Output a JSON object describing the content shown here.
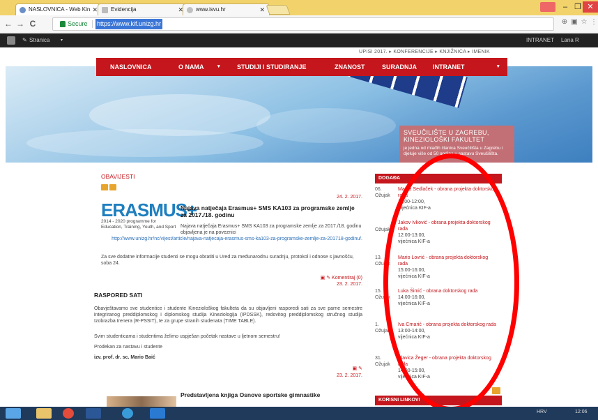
{
  "browser": {
    "tabs": [
      {
        "label": "NASLOVNICA - Web Kin"
      },
      {
        "label": "Evidencija"
      },
      {
        "label": "www.isvu.hr"
      }
    ],
    "user_badge": "",
    "window_controls": {
      "minimize": "–",
      "maximize": "❐",
      "close": "✕"
    },
    "back": "←",
    "forward": "→",
    "reload": "C",
    "secure_label": "Secure",
    "url": "https://www.kif.unizg.hr",
    "icons": [
      "zoom-icon",
      "translate-icon",
      "star-icon",
      "menu-icon"
    ]
  },
  "wp_admin": {
    "site_menu": "Stranica",
    "right_links": [
      "INTRANET",
      "Lana R"
    ]
  },
  "site": {
    "toplinks": "UPISI 2017.  ▸ KONFERENCIJE  ▸ KNJIŽNICA  ▸ IMENIK",
    "nav": [
      {
        "label": "NASLOVNICA"
      },
      {
        "label": "O NAMA"
      },
      {
        "label": "▾"
      },
      {
        "label": "STUDIJI I STUDIRANJE"
      },
      {
        "label": "ZNANOST"
      },
      {
        "label": "SURADNJA"
      },
      {
        "label": "INTRANET"
      },
      {
        "label": "▾"
      }
    ],
    "hero": {
      "title": "SVEUČILIŠTE U ZAGREBU, KINEZIOLOŠKI FAKULTET",
      "text": "je jedna od mlađih članica Sveučilišta u Zagrebu i djeluje više od 50 godina u sastavu Sveučilišta."
    },
    "news": {
      "heading": "OBAVIJESTI",
      "date1": "24. 2. 2017.",
      "erasmus_logo": "ERASMUS+",
      "erasmus_sub": "2014 - 2020 programme for Education, Training, Youth, and Sport",
      "art1_title": "Najava natječaja Erasmus+ SMS KA103 za programske zemlje za 2017./18. godinu",
      "art1_text": "Najava natječaja Erasmus+ SMS KA103 za programske zemlje za 2017./18. godinu objavljena je na poveznici",
      "art1_link": "http://www.unizg.hr/nc/vijest/article/najava-natjecaja-erasmus-sms-ka103-za-programske-zemlje-za-201718-godinu/.",
      "art1_extra": "Za sve dodatne informacije studenti se mogu obratiti u Ured za međunarodnu suradnju, protokol i odnose s javnošću, soba 24.",
      "comment": "Komentiraj (0)",
      "date2": "23. 2. 2017.",
      "art2_title": "RASPORED SATI",
      "art2_p1": "Obavještavamo sve studentice i studente Kineziološkog fakulteta da su objavljeni rasporedi sati za sve parne semestre integriranog preddiplomskog i diplomskog studija Kineziologija (IPDSSK), redovitog preddiplomskog stručnog studija Izobrazba trenera (R-PSSIT), te za grupe stranih studenata (TIME TABLE).",
      "art2_p2": "Svim studenticama i studentima želimo uspješan početak nastave u ljetnom semestru!",
      "art2_p3": "Prodekan za nastavu i studente",
      "art2_sign": "izv. prof. dr. sc. Mario Baić",
      "date3": "23. 2. 2017.",
      "art3_title": "Predstavljena knjiga Osnove sportske gimnastike"
    },
    "events": {
      "heading": "DOGAĐA",
      "items": [
        {
          "day": "06.",
          "month": "Ožujak",
          "name": "Matea Sedlaček - obrana projekta doktorskog rada",
          "time": "11:00-12:00,",
          "place": "Vijećnica KIF-a"
        },
        {
          "day": "",
          "month": "Ožujak",
          "name": "Jakov Ivković - obrana projekta doktorskog rada",
          "time": "12:00-13:00,",
          "place": "vijećnica KIF-a"
        },
        {
          "day": "13.",
          "month": "Ožujak",
          "name": "Mario Lovrić - obrana projekta doktorskog rada",
          "time": "15:00-16:00,",
          "place": "vijećnica KIF-a"
        },
        {
          "day": "15.",
          "month": "Ožujak",
          "name": "Luka Šimić - obrana doktorskog rada",
          "time": "14:00-16:00,",
          "place": "vijećnica KIF-a"
        },
        {
          "day": "1.",
          "month": "Ožujak",
          "name": "Iva Crnarić - obrana projekta doktorskog rada",
          "time": "13:00-14:00,",
          "place": "vijećnica KIF-a"
        },
        {
          "day": "31.",
          "month": "Ožujak",
          "name": "Slavica Žeger - obrana projekta doktorskog rada",
          "time": "14:00-15:00,",
          "place": "vijećnica KIF-a"
        }
      ],
      "links_heading": "KORISNI LINKOVI"
    }
  },
  "taskbar": {
    "lang": "HRV",
    "time": "12:06"
  },
  "colors": {
    "brand_red": "#c4161c",
    "annotation_red": "#ff0000",
    "tab_yellow": "#f2d36b"
  }
}
